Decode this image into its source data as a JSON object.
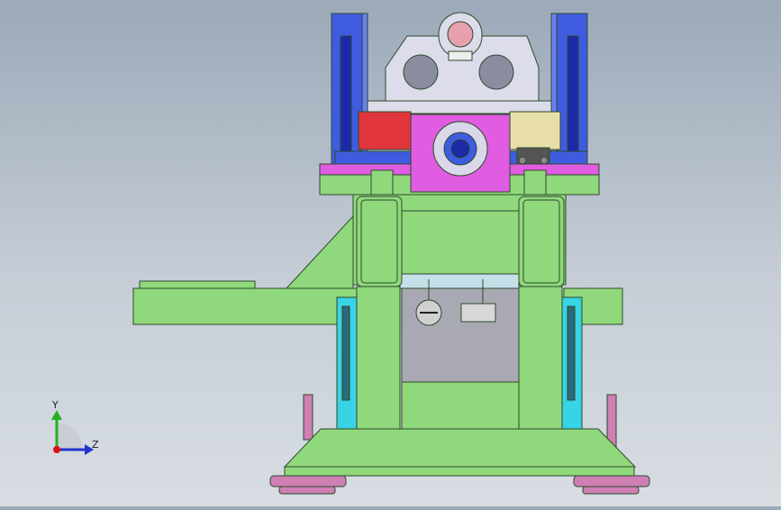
{
  "viewport": {
    "background_top": "#9ba9b8",
    "background_bottom": "#d8dde3"
  },
  "colors": {
    "frame_green": "#90d87c",
    "edge": "#2b4a2b",
    "column_blue": "#3f5ce0",
    "column_dark_blue": "#1c2aa8",
    "plate_magenta": "#e05ce0",
    "block_red": "#e0353d",
    "block_yellow": "#e8dfa8",
    "bracket_grey": "#dcdcea",
    "rail_cyan": "#39d3e6",
    "base_pink": "#cf7fb4",
    "panel_grey": "#a9a9b4"
  },
  "triad": {
    "y_label": "Y",
    "z_label": "Z",
    "y_color": "#22b022",
    "z_color": "#2233cc",
    "x_color": "#dd1111"
  }
}
